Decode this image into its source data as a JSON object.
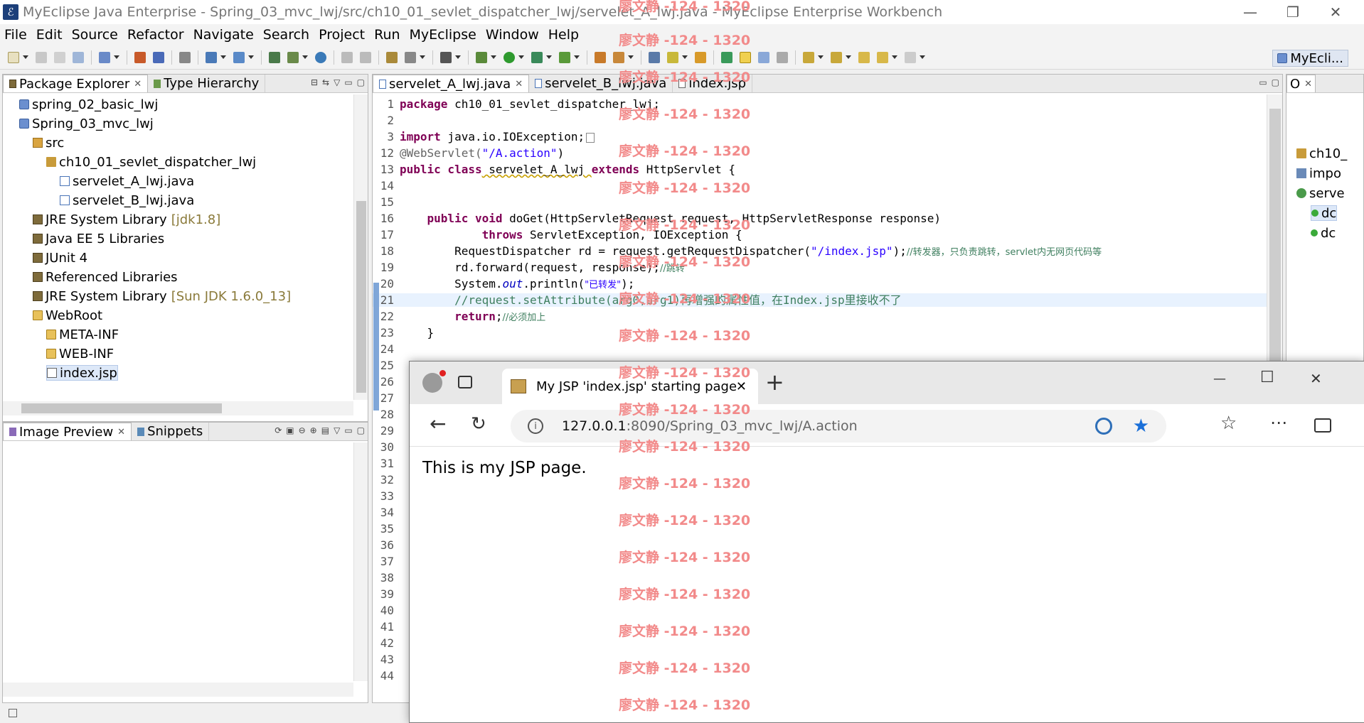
{
  "window": {
    "title": "MyEclipse Java Enterprise - Spring_03_mvc_lwj/src/ch10_01_sevlet_dispatcher_lwj/servelet_A_lwj.java - MyEclipse Enterprise Workbench",
    "minimize": "—",
    "maximize": "❐",
    "close": "✕"
  },
  "menu": [
    "File",
    "Edit",
    "Source",
    "Refactor",
    "Navigate",
    "Search",
    "Project",
    "Run",
    "MyEclipse",
    "Window",
    "Help"
  ],
  "perspective": "MyEcli...",
  "package_explorer": {
    "tabs": [
      "Package Explorer",
      "Type Hierarchy"
    ],
    "items": [
      {
        "label": "spring_02_basic_lwj",
        "icon": "project-icon"
      },
      {
        "label": "Spring_03_mvc_lwj",
        "icon": "project-icon"
      },
      {
        "label": "src",
        "icon": "source-folder-icon"
      },
      {
        "label": "ch10_01_sevlet_dispatcher_lwj",
        "icon": "package-icon"
      },
      {
        "label": "servelet_A_lwj.java",
        "icon": "java-file-icon"
      },
      {
        "label": "servelet_B_lwj.java",
        "icon": "java-file-icon"
      },
      {
        "label": "JRE System Library",
        "suffix": "[jdk1.8]",
        "icon": "library-icon"
      },
      {
        "label": "Java EE 5 Libraries",
        "icon": "library-icon"
      },
      {
        "label": "JUnit 4",
        "icon": "library-icon"
      },
      {
        "label": "Referenced Libraries",
        "icon": "library-icon"
      },
      {
        "label": "JRE System Library",
        "suffix": "[Sun JDK 1.6.0_13]",
        "icon": "library-icon"
      },
      {
        "label": "WebRoot",
        "icon": "folder-icon"
      },
      {
        "label": "META-INF",
        "icon": "folder-icon"
      },
      {
        "label": "WEB-INF",
        "icon": "folder-icon"
      },
      {
        "label": "index.jsp",
        "icon": "jsp-file-icon"
      }
    ]
  },
  "bottom_panel": {
    "tabs": [
      "Image Preview",
      "Snippets"
    ]
  },
  "editor": {
    "tabs": [
      "servelet_A_lwj.java",
      "servelet_B_lwj.java",
      "index.jsp"
    ],
    "lines": [
      {
        "n": "1"
      },
      {
        "n": "2"
      },
      {
        "n": "3"
      },
      {
        "n": "12"
      },
      {
        "n": "13"
      },
      {
        "n": "14"
      },
      {
        "n": "15"
      },
      {
        "n": "16"
      },
      {
        "n": "17"
      },
      {
        "n": "18"
      },
      {
        "n": "19"
      },
      {
        "n": "20"
      },
      {
        "n": "21"
      },
      {
        "n": "22"
      },
      {
        "n": "23"
      },
      {
        "n": "24"
      },
      {
        "n": "25"
      },
      {
        "n": "26"
      },
      {
        "n": "27"
      },
      {
        "n": "28"
      },
      {
        "n": "29"
      },
      {
        "n": "30"
      },
      {
        "n": "31"
      },
      {
        "n": "32"
      },
      {
        "n": "33"
      },
      {
        "n": "34"
      },
      {
        "n": "35"
      },
      {
        "n": "36"
      },
      {
        "n": "37"
      },
      {
        "n": "38"
      },
      {
        "n": "39"
      },
      {
        "n": "40"
      },
      {
        "n": "41"
      },
      {
        "n": "42"
      },
      {
        "n": "43"
      },
      {
        "n": "44"
      }
    ],
    "code": {
      "l1_kw": "package",
      "l1_rest": " ch10_01_sevlet_dispatcher_lwj;",
      "l3_kw": "import",
      "l3_rest": " java.io.IOException;",
      "l12_ann": "@WebServlet(",
      "l12_str": "\"/A.action\"",
      "l12_end": ")",
      "l13_kw1": "public class",
      "l13_name": " servelet_A_lwj ",
      "l13_kw2": "extends",
      "l13_rest": " HttpServlet {",
      "l16_kw": "public void",
      "l16_rest": " doGet(HttpServletRequest request, HttpServletResponse response)",
      "l17_kw": "throws",
      "l17_rest": " ServletException, IOException {",
      "l18_a": "RequestDispatcher rd = request.getRequestDispatcher(",
      "l18_str": "\"/index.jsp\"",
      "l18_b": ");",
      "l18_cm": "//转发器，只负责跳转，servlet内无网页代码等",
      "l19_a": "rd.forward(request, response);",
      "l19_cm": "//跳转",
      "l20_a": "System.",
      "l20_it": "out",
      "l20_b": ".println(",
      "l20_str": "\"已转发\"",
      "l20_c": ");",
      "l21_cm": "//request.setAttribute(arg0,arg1)再增强的属性值，在Index.jsp里接收不了",
      "l22_kw": "return",
      "l22_b": ";",
      "l22_cm": "//必须加上",
      "l23": "}"
    }
  },
  "outline": {
    "tab": "O",
    "items": [
      "ch10_",
      "impo",
      "serve",
      "dc",
      "dc"
    ]
  },
  "browser": {
    "tab_title": "My JSP 'index.jsp' starting page",
    "tab_close": "✕",
    "new_tab": "+",
    "url_host": "127.0.0.1",
    "url_rest": ":8090/Spring_03_mvc_lwj/A.action",
    "content": "This is my JSP page.",
    "minimize": "—",
    "maximize": "☐",
    "close": "✕"
  },
  "watermark": "廖文静 -124 - 1320"
}
